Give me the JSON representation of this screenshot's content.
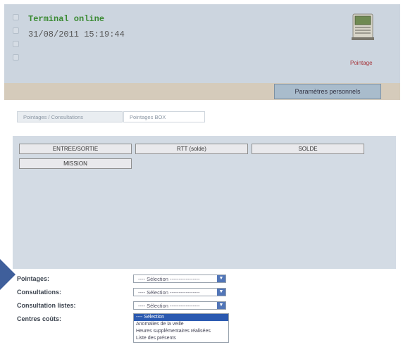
{
  "terminal": {
    "status": "Terminal online",
    "datetime": "31/08/2011 15:19:44",
    "pointage_label": "Pointage",
    "device_icon": "terminal-device-icon"
  },
  "header": {
    "personal_settings": "Paramètres personnels"
  },
  "tabs": [
    {
      "label": "Pointages / Consultations"
    },
    {
      "label": "Pointages BOX"
    }
  ],
  "buttons": {
    "entree_sortie": "ENTREE/SORTIE",
    "rtt": "RTT (solde)",
    "solde": "SOLDE",
    "mission": "MISSION"
  },
  "form": {
    "pointages_label": "Pointages:",
    "consultations_label": "Consultations:",
    "consultation_listes_label": "Consultation listes:",
    "centres_couts_label": "Centres coûts:",
    "select_placeholder": "---- Sélection -----------------",
    "dropdown_options": [
      "---- Sélection",
      "Anomalies de la veille",
      "Heures supplémentaires réalisées",
      "Liste des présents"
    ]
  },
  "colors": {
    "header_bg": "#ccd5df",
    "status_green": "#3a8a32",
    "accent_red": "#a5343a",
    "selected_blue": "#2a59b0"
  }
}
